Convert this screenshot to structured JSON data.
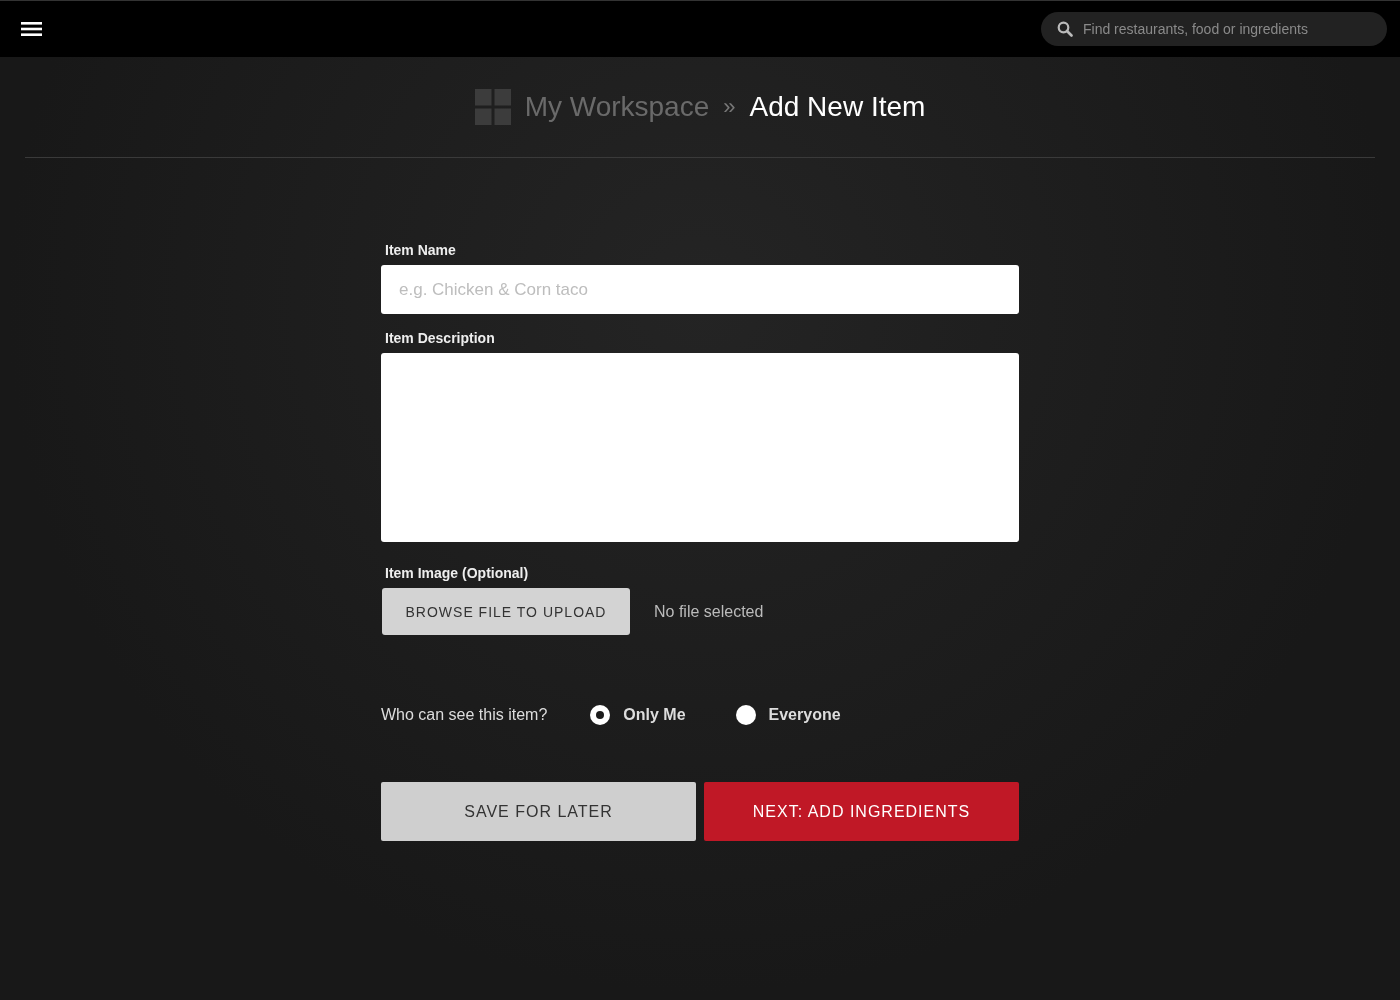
{
  "topbar": {
    "search": {
      "placeholder": "Find restaurants, food or ingredients"
    }
  },
  "breadcrumb": {
    "parent": "My Workspace",
    "separator": "»",
    "current": "Add New Item"
  },
  "form": {
    "name_field": {
      "label": "Item Name",
      "placeholder": "e.g. Chicken & Corn taco"
    },
    "description_field": {
      "label": "Item Description"
    },
    "image_field": {
      "label": "Item Image (Optional)",
      "button": "BROWSE FILE TO UPLOAD",
      "status": "No file selected"
    },
    "visibility": {
      "label": "Who can see this item?",
      "options": [
        {
          "label": "Only Me",
          "selected": true
        },
        {
          "label": "Everyone",
          "selected": false
        }
      ]
    },
    "buttons": [
      {
        "label": "SAVE FOR LATER",
        "kind": "secondary"
      },
      {
        "label": "NEXT: ADD INGREDIENTS",
        "kind": "primary"
      }
    ]
  }
}
